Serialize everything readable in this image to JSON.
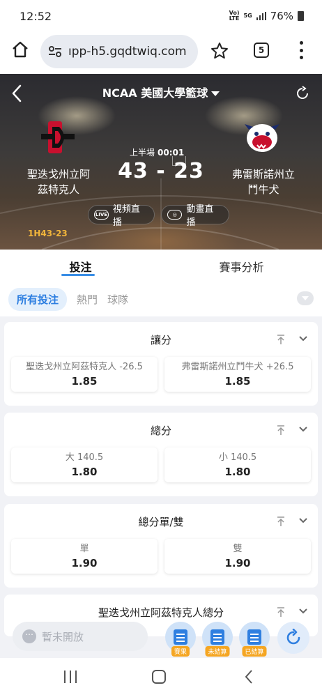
{
  "status_bar": {
    "time": "12:52",
    "net1": "Vo) LTE",
    "net2": "5G",
    "battery": "76%"
  },
  "browser": {
    "url": "ıpp-h5.gqdtwiq.com",
    "tabs_count": "5"
  },
  "match": {
    "league": "NCAA 美國大學籃球",
    "home_team_line1": "聖迭戈州立阿",
    "home_team_line2": "茲特克人",
    "away_team_line1": "弗雷斯諾州立",
    "away_team_line2": "鬥牛犬",
    "period": "上半場",
    "clock": "00:01",
    "score": "43 - 23",
    "quarter_score": "1H43-23",
    "live_label": "視頻直播",
    "anim_label": "動畫直播",
    "live_icon": "LIVE"
  },
  "tabs": [
    {
      "label": "投注",
      "active": true
    },
    {
      "label": "賽事分析",
      "active": false
    }
  ],
  "filters": [
    {
      "label": "所有投注",
      "active": true
    },
    {
      "label": "熱門",
      "active": false
    },
    {
      "label": "球隊",
      "active": false
    }
  ],
  "markets": [
    {
      "title": "讓分",
      "options": [
        {
          "label": "聖迭戈州立阿茲特克人 -26.5",
          "odds": "1.85"
        },
        {
          "label": "弗雷斯諾州立鬥牛犬 +26.5",
          "odds": "1.85"
        }
      ]
    },
    {
      "title": "總分",
      "options": [
        {
          "label": "大 140.5",
          "odds": "1.80"
        },
        {
          "label": "小 140.5",
          "odds": "1.80"
        }
      ]
    },
    {
      "title": "總分單/雙",
      "options": [
        {
          "label": "單",
          "odds": "1.90"
        },
        {
          "label": "雙",
          "odds": "1.90"
        }
      ]
    },
    {
      "title": "聖迭戈州立阿茲特克人總分",
      "options": []
    }
  ],
  "action_bar": {
    "chat_placeholder": "暫未開放",
    "btn_results": "賽果",
    "btn_unsettled": "未結算",
    "btn_settled": "已結算"
  },
  "colors": {
    "accent": "#3a8ee6",
    "quarter_score": "#f1b53b",
    "tag": "#f5a623"
  }
}
